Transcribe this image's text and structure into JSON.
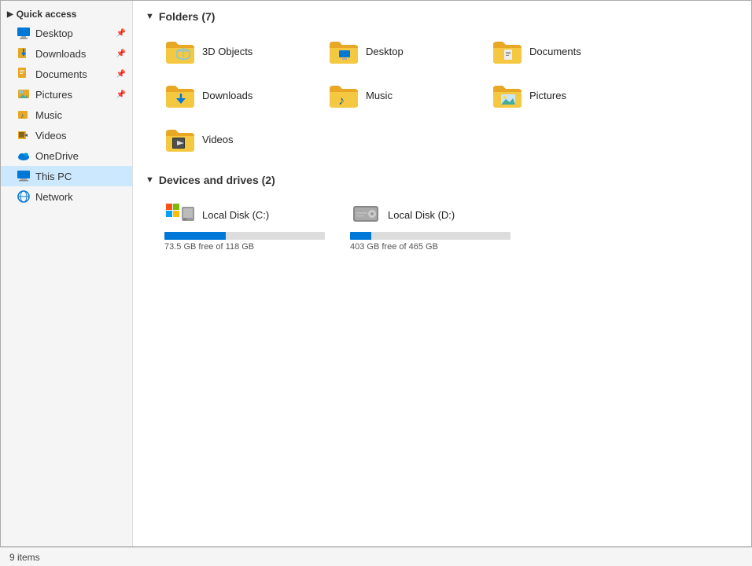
{
  "sidebar": {
    "quick_access_label": "Quick access",
    "items_quick": [
      {
        "label": "Desktop",
        "pinned": true,
        "icon": "desktop-icon"
      },
      {
        "label": "Downloads",
        "pinned": true,
        "icon": "downloads-icon"
      },
      {
        "label": "Documents",
        "pinned": true,
        "icon": "documents-icon"
      },
      {
        "label": "Pictures",
        "pinned": true,
        "icon": "pictures-icon"
      },
      {
        "label": "Music",
        "pinned": false,
        "icon": "music-icon"
      },
      {
        "label": "Videos",
        "pinned": false,
        "icon": "videos-icon"
      },
      {
        "label": "OneDrive",
        "pinned": false,
        "icon": "onedrive-icon"
      }
    ],
    "this_pc_label": "This PC",
    "network_label": "Network"
  },
  "main": {
    "folders_section_label": "Folders (7)",
    "folders": [
      {
        "name": "3D Objects",
        "type": "3dobjects"
      },
      {
        "name": "Desktop",
        "type": "desktop"
      },
      {
        "name": "Documents",
        "type": "documents"
      },
      {
        "name": "Downloads",
        "type": "downloads"
      },
      {
        "name": "Music",
        "type": "music"
      },
      {
        "name": "Pictures",
        "type": "pictures"
      },
      {
        "name": "Videos",
        "type": "videos"
      }
    ],
    "devices_section_label": "Devices and drives (2)",
    "drives": [
      {
        "name": "Local Disk (C:)",
        "free": "73.5 GB free of 118 GB",
        "free_gb": 73.5,
        "total_gb": 118,
        "used_pct": 38
      },
      {
        "name": "Local Disk (D:)",
        "free": "403 GB free of 465 GB",
        "free_gb": 403,
        "total_gb": 465,
        "used_pct": 13
      }
    ]
  },
  "status_bar": {
    "items_count": "9 items"
  },
  "colors": {
    "folder_body": "#e8a825",
    "folder_tab": "#f5c842",
    "drive_bar": "#0078d7",
    "drive_bar_bg": "#c8c8c8",
    "active_item_bg": "#cce8ff",
    "accent": "#0078d7"
  }
}
